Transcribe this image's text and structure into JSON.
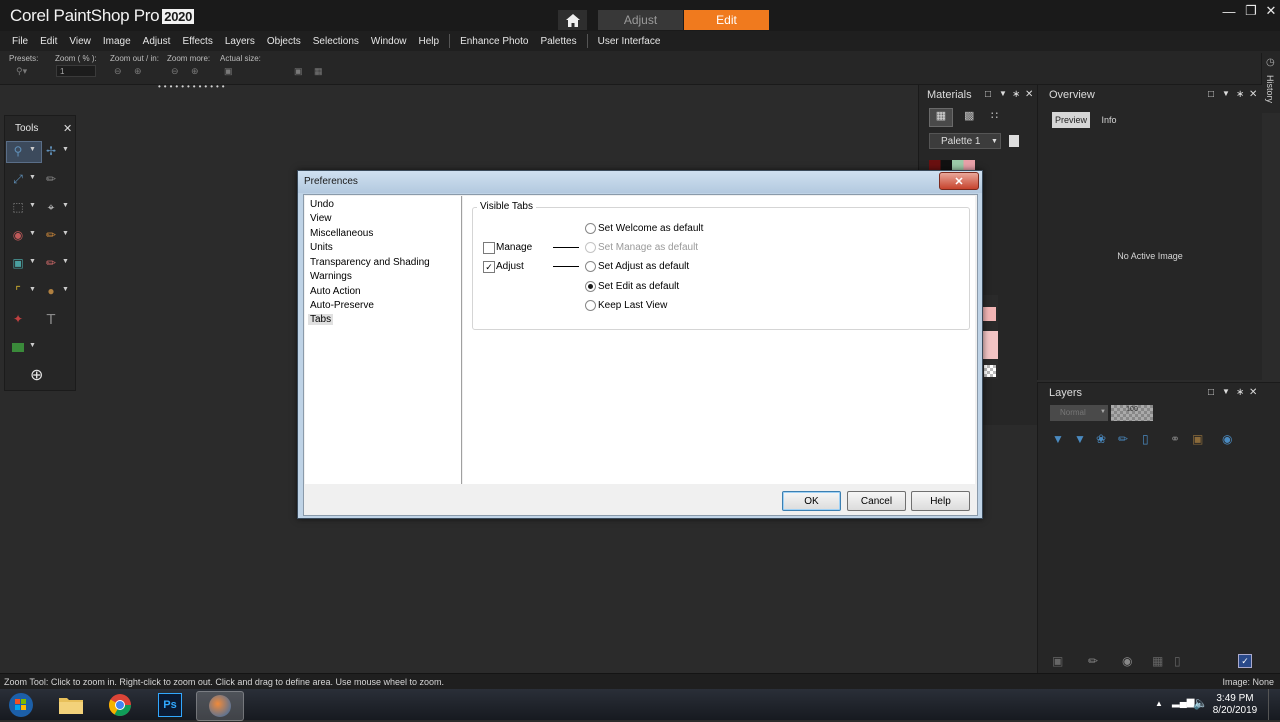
{
  "app": {
    "brand_name": "Corel PaintShop Pro",
    "brand_version": "2020",
    "workspace_tabs": [
      {
        "label": "Adjust",
        "active": false
      },
      {
        "label": "Edit",
        "active": true
      }
    ],
    "accent_color": "#f07a1e"
  },
  "menu": [
    "File",
    "Edit",
    "View",
    "Image",
    "Adjust",
    "Effects",
    "Layers",
    "Objects",
    "Selections",
    "Window",
    "Help",
    "Enhance Photo",
    "Palettes",
    "User Interface"
  ],
  "toolbar": {
    "presets_label": "Presets:",
    "zoom_label": "Zoom ( % ):",
    "zoom_value": "1",
    "zoom_out_label": "Zoom out / in:",
    "zoom_more_label": "Zoom more:",
    "actual_size_label": "Actual size:"
  },
  "tools_palette": {
    "title": "Tools"
  },
  "materials": {
    "title": "Materials",
    "palette_select": "Palette 1"
  },
  "overview": {
    "title": "Overview",
    "tabs": [
      "Preview",
      "Info"
    ],
    "empty_message": "No Active Image"
  },
  "history": {
    "title": "History"
  },
  "layers": {
    "title": "Layers",
    "blend_mode": "Normal",
    "opacity": "100"
  },
  "dialog": {
    "title": "Preferences",
    "categories": [
      "Undo",
      "View",
      "Miscellaneous",
      "Units",
      "Transparency and Shading",
      "Warnings",
      "Auto Action",
      "Auto-Preserve",
      "Tabs"
    ],
    "selected_category": "Tabs",
    "group_title": "Visible Tabs",
    "checkboxes": [
      {
        "label": "Manage",
        "checked": false
      },
      {
        "label": "Adjust",
        "checked": true
      }
    ],
    "radios": [
      {
        "label": "Set Welcome as default",
        "checked": false,
        "enabled": true
      },
      {
        "label": "Set Manage as default",
        "checked": false,
        "enabled": false
      },
      {
        "label": "Set Adjust as default",
        "checked": false,
        "enabled": true
      },
      {
        "label": "Set Edit as default",
        "checked": true,
        "enabled": true
      },
      {
        "label": "Keep Last View",
        "checked": false,
        "enabled": true
      }
    ],
    "buttons": {
      "ok": "OK",
      "cancel": "Cancel",
      "help": "Help"
    }
  },
  "status": {
    "text": "Zoom Tool: Click to zoom in. Right-click to zoom out. Click and drag to define area. Use mouse wheel to zoom.",
    "image": "Image: None"
  },
  "taskbar": {
    "time": "3:49 PM",
    "date": "8/20/2019"
  }
}
